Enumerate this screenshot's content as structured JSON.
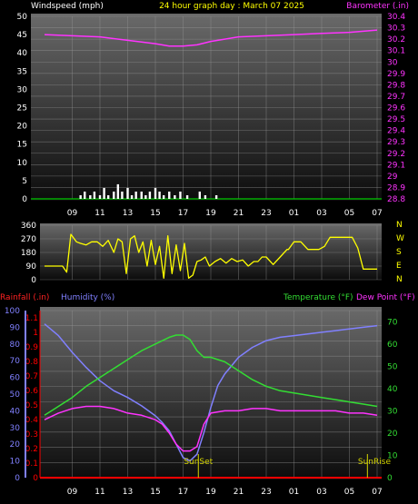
{
  "colors": {
    "wind": "#ffffff",
    "barometer": "#ff33ff",
    "direction": "#ffff00",
    "rainfall": "#ff0000",
    "humidity": "#8080ff",
    "temperature": "#33dd33",
    "dewpoint": "#ff33ff",
    "sun": "#d4d400",
    "grid": "#9a9a9a"
  },
  "chart_data": [
    {
      "type": "line",
      "title": "24 hour graph day : March 07 2025",
      "ylabel_left": "Windspeed (mph)",
      "ylabel_right": "Barometer (.in)",
      "x_ticks": [
        "09",
        "11",
        "13",
        "15",
        "17",
        "19",
        "21",
        "23",
        "01",
        "03",
        "05",
        "07"
      ],
      "y_ticks_left": [
        "0",
        "5",
        "10",
        "15",
        "20",
        "25",
        "30",
        "35",
        "40",
        "45",
        "50"
      ],
      "y_ticks_right": [
        "28.8",
        "28.9",
        "29",
        "29.1",
        "29.2",
        "29.3",
        "29.4",
        "29.5",
        "29.6",
        "29.7",
        "29.8",
        "29.9",
        "30",
        "30.1",
        "30.2",
        "30.3",
        "30.4"
      ],
      "ylim_left": [
        0,
        50
      ],
      "ylim_right": [
        28.8,
        30.4
      ],
      "xlim_hours": [
        7,
        31
      ],
      "grid": true,
      "series": [
        {
          "name": "Barometer",
          "axis": "right",
          "x": [
            7,
            9,
            11,
            13,
            15,
            16,
            17,
            18,
            19,
            21,
            23,
            25,
            27,
            29,
            31
          ],
          "values": [
            30.24,
            30.23,
            30.22,
            30.19,
            30.16,
            30.14,
            30.14,
            30.15,
            30.18,
            30.22,
            30.23,
            30.24,
            30.25,
            30.26,
            30.28
          ]
        },
        {
          "name": "Windspeed",
          "axis": "left",
          "type": "bar",
          "x": [
            9.6,
            9.9,
            10.3,
            10.6,
            11.0,
            11.3,
            11.6,
            12.0,
            12.3,
            12.6,
            13.0,
            13.3,
            13.6,
            14.0,
            14.3,
            14.6,
            15.0,
            15.3,
            15.6,
            16.0,
            16.4,
            16.8,
            17.3,
            18.2,
            18.6,
            19.4
          ],
          "values": [
            1,
            2,
            1,
            2,
            1,
            3,
            1,
            2,
            4,
            2,
            3,
            1,
            2,
            2,
            1,
            2,
            3,
            2,
            1,
            2,
            1,
            2,
            1,
            2,
            1,
            1
          ]
        }
      ]
    },
    {
      "type": "line",
      "ylabel_right": [
        "N",
        "W",
        "S",
        "E",
        "N"
      ],
      "y_ticks_left": [
        "0",
        "90",
        "180",
        "270",
        "360"
      ],
      "ylim": [
        0,
        360
      ],
      "xlim_hours": [
        7,
        31
      ],
      "grid": true,
      "series": [
        {
          "name": "Wind Direction",
          "x": [
            7,
            8.3,
            8.6,
            8.9,
            9.3,
            9.6,
            10,
            10.4,
            10.8,
            11.2,
            11.6,
            12,
            12.3,
            12.6,
            12.9,
            13.2,
            13.5,
            13.8,
            14.1,
            14.4,
            14.7,
            15,
            15.3,
            15.6,
            15.9,
            16.2,
            16.5,
            16.8,
            17.1,
            17.4,
            17.7,
            18,
            18.3,
            18.6,
            18.9,
            19.3,
            19.7,
            20.1,
            20.5,
            20.9,
            21.3,
            21.7,
            22.1,
            22.4,
            22.7,
            23,
            23.5,
            24,
            24.5,
            24.6,
            25,
            25.5,
            26,
            26.8,
            27.2,
            27.6,
            28,
            28.4,
            28.8,
            29.2,
            29.6,
            30,
            30.5,
            31
          ],
          "values": [
            90,
            90,
            50,
            300,
            250,
            240,
            230,
            250,
            250,
            220,
            260,
            180,
            270,
            250,
            40,
            270,
            290,
            180,
            250,
            90,
            260,
            100,
            220,
            10,
            290,
            40,
            230,
            60,
            240,
            10,
            30,
            120,
            130,
            150,
            90,
            120,
            140,
            110,
            140,
            120,
            130,
            90,
            120,
            120,
            150,
            150,
            100,
            150,
            200,
            200,
            250,
            250,
            200,
            200,
            220,
            280,
            280,
            280,
            280,
            280,
            210,
            70,
            70,
            70
          ]
        }
      ]
    },
    {
      "type": "line",
      "ylabel_left_1": "Rainfall (.in)",
      "ylabel_left_2": "Humidity (%)",
      "ylabel_right_1": "Temperature (°F)",
      "ylabel_right_2": "Dew Point (°F)",
      "y_ticks_rain": [
        "0",
        "0.1",
        "0.2",
        "0.3",
        "0.4",
        "0.5",
        "0.6",
        "0.7",
        "0.8",
        "0.9",
        "1",
        "1.1"
      ],
      "y_ticks_humidity": [
        "0",
        "10",
        "20",
        "30",
        "40",
        "50",
        "60",
        "70",
        "80",
        "90",
        "100"
      ],
      "y_ticks_temp": [
        "0",
        "10",
        "20",
        "30",
        "40",
        "50",
        "60",
        "70"
      ],
      "ylim_rain": [
        0,
        1.15
      ],
      "ylim_humidity": [
        0,
        100
      ],
      "ylim_temp": [
        0,
        75
      ],
      "x_ticks": [
        "09",
        "11",
        "13",
        "15",
        "17",
        "19",
        "21",
        "23",
        "01",
        "03",
        "05",
        "07"
      ],
      "xlim_hours": [
        7,
        31
      ],
      "grid": true,
      "annotations": [
        {
          "label": "SunSet",
          "x": 18.1
        },
        {
          "label": "SunRise",
          "x": 30.3
        }
      ],
      "series": [
        {
          "name": "Humidity",
          "axis": "humidity",
          "x": [
            7,
            8,
            9,
            10,
            11,
            12,
            13,
            14,
            15,
            15.5,
            16,
            16.5,
            17,
            17.5,
            18,
            18.5,
            19,
            19.5,
            20,
            21,
            22,
            23,
            24,
            25,
            26,
            27,
            28,
            29,
            30,
            31
          ],
          "values": [
            92,
            85,
            75,
            66,
            58,
            52,
            48,
            43,
            37,
            33,
            28,
            20,
            12,
            10,
            14,
            27,
            42,
            55,
            62,
            72,
            78,
            82,
            84,
            85,
            86,
            87,
            88,
            89,
            90,
            91
          ]
        },
        {
          "name": "Temperature",
          "axis": "temp",
          "x": [
            7,
            8,
            9,
            10,
            11,
            12,
            13,
            14,
            15,
            16,
            16.5,
            17,
            17.5,
            18,
            18.5,
            19,
            20,
            21,
            22,
            23,
            24,
            25,
            26,
            27,
            28,
            29,
            30,
            31
          ],
          "values": [
            28,
            32,
            36,
            41,
            45,
            49,
            53,
            57,
            60,
            63,
            64,
            64,
            62,
            57,
            54,
            54,
            52,
            48,
            44,
            41,
            39,
            38,
            37,
            36,
            35,
            34,
            33,
            32
          ]
        },
        {
          "name": "Dew Point",
          "axis": "temp",
          "x": [
            7,
            8,
            9,
            10,
            11,
            12,
            13,
            14,
            15,
            15.5,
            16,
            16.5,
            17,
            17.5,
            18,
            18.5,
            19,
            20,
            21,
            22,
            23,
            24,
            25,
            26,
            27,
            28,
            29,
            30,
            31
          ],
          "values": [
            26,
            29,
            31,
            32,
            32,
            31,
            29,
            28,
            26,
            24,
            20,
            15,
            12,
            12,
            14,
            24,
            29,
            30,
            30,
            31,
            31,
            30,
            30,
            30,
            30,
            30,
            29,
            29,
            28
          ]
        },
        {
          "name": "Rainfall",
          "axis": "rain",
          "x": [
            7,
            31
          ],
          "values": [
            0,
            0
          ]
        }
      ]
    }
  ]
}
